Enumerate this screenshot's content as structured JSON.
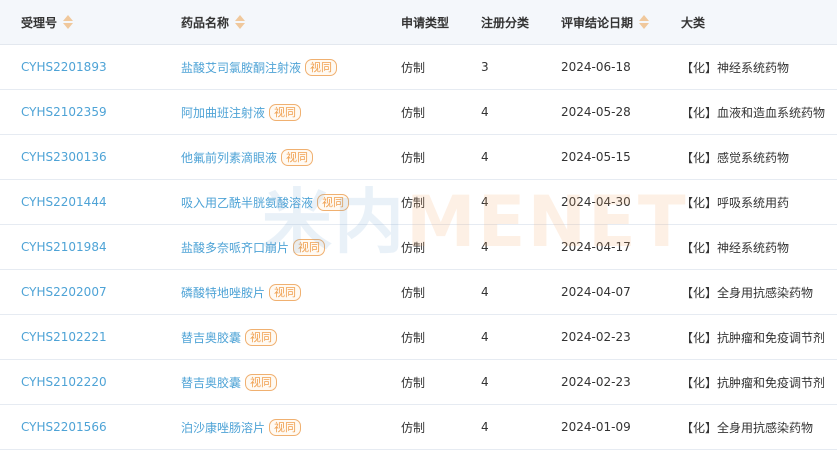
{
  "headers": {
    "accept_no": "受理号",
    "drug_name": "药品名称",
    "apply_type": "申请类型",
    "reg_class": "注册分类",
    "review_date": "评审结论日期",
    "category": "大类"
  },
  "badge_label": "视同",
  "rows": [
    {
      "accept_no": "CYHS2201893",
      "drug_name": "盐酸艾司氯胺酮注射液",
      "apply_type": "仿制",
      "reg_class": "3",
      "review_date": "2024-06-18",
      "category": "【化】神经系统药物"
    },
    {
      "accept_no": "CYHS2102359",
      "drug_name": "阿加曲班注射液",
      "apply_type": "仿制",
      "reg_class": "4",
      "review_date": "2024-05-28",
      "category": "【化】血液和造血系统药物"
    },
    {
      "accept_no": "CYHS2300136",
      "drug_name": "他氟前列素滴眼液",
      "apply_type": "仿制",
      "reg_class": "4",
      "review_date": "2024-05-15",
      "category": "【化】感觉系统药物"
    },
    {
      "accept_no": "CYHS2201444",
      "drug_name": "吸入用乙酰半胱氨酸溶液",
      "apply_type": "仿制",
      "reg_class": "4",
      "review_date": "2024-04-30",
      "category": "【化】呼吸系统用药"
    },
    {
      "accept_no": "CYHS2101984",
      "drug_name": "盐酸多奈哌齐口崩片",
      "apply_type": "仿制",
      "reg_class": "4",
      "review_date": "2024-04-17",
      "category": "【化】神经系统药物"
    },
    {
      "accept_no": "CYHS2202007",
      "drug_name": "磷酸特地唑胺片",
      "apply_type": "仿制",
      "reg_class": "4",
      "review_date": "2024-04-07",
      "category": "【化】全身用抗感染药物"
    },
    {
      "accept_no": "CYHS2102221",
      "drug_name": "替吉奥胶囊",
      "apply_type": "仿制",
      "reg_class": "4",
      "review_date": "2024-02-23",
      "category": "【化】抗肿瘤和免疫调节剂"
    },
    {
      "accept_no": "CYHS2102220",
      "drug_name": "替吉奥胶囊",
      "apply_type": "仿制",
      "reg_class": "4",
      "review_date": "2024-02-23",
      "category": "【化】抗肿瘤和免疫调节剂"
    },
    {
      "accept_no": "CYHS2201566",
      "drug_name": "泊沙康唑肠溶片",
      "apply_type": "仿制",
      "reg_class": "4",
      "review_date": "2024-01-09",
      "category": "【化】全身用抗感染药物"
    }
  ],
  "watermark": {
    "cn": "米内",
    "en": "MENET"
  }
}
